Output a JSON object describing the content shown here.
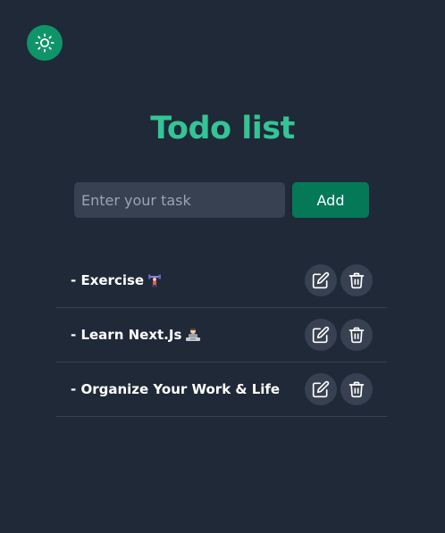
{
  "theme_toggle": {
    "icon": "sun-icon"
  },
  "title": "Todo list",
  "input": {
    "placeholder": "Enter your task",
    "value": ""
  },
  "add_button": {
    "label": "Add"
  },
  "tasks": [
    {
      "label": "- Exercise",
      "emoji_icon": "weightlifter-icon"
    },
    {
      "label": "- Learn Next.Js",
      "emoji_icon": "technologist-icon"
    },
    {
      "label": "- Organize Your Work & Life"
    }
  ],
  "colors": {
    "background": "#1f2937",
    "accent": "#34c495",
    "toggle": "#0f9468",
    "add_button": "#047857",
    "surface": "#374151"
  }
}
